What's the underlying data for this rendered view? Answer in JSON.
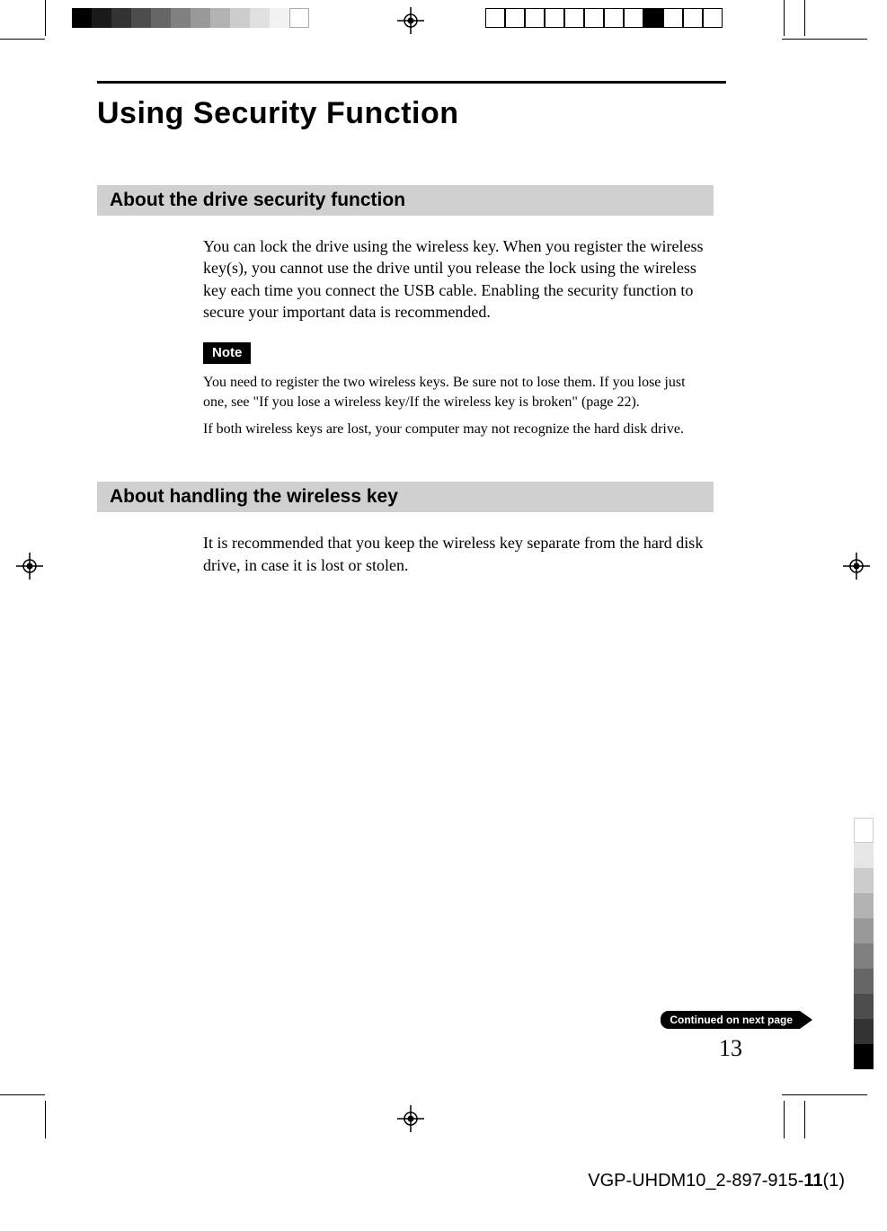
{
  "page": {
    "title": "Using Security Function",
    "sections": [
      {
        "header": "About the drive security function",
        "paragraphs": [
          "You can lock the drive using the wireless key. When you register the wireless key(s), you cannot use the drive until you release the lock using the wireless key each time you connect the USB cable. Enabling the security function to secure your important data is recommended."
        ],
        "note_label": "Note",
        "notes": [
          "You need to register the two wireless keys. Be sure not to lose them. If you lose just one, see \"If you lose a wireless key/If the wireless key is broken\" (page 22).",
          "If both wireless keys are lost, your computer may not recognize the hard disk drive."
        ]
      },
      {
        "header": "About handling the wireless key",
        "paragraphs": [
          "It is recommended that you keep the wireless key separate from the hard disk drive,  in case it is lost or stolen."
        ]
      }
    ],
    "continued_label": "Continued on next page",
    "page_number": "13",
    "footer_prefix": "VGP-UHDM10_2-897-915-",
    "footer_bold": "11",
    "footer_suffix": "(1)"
  }
}
